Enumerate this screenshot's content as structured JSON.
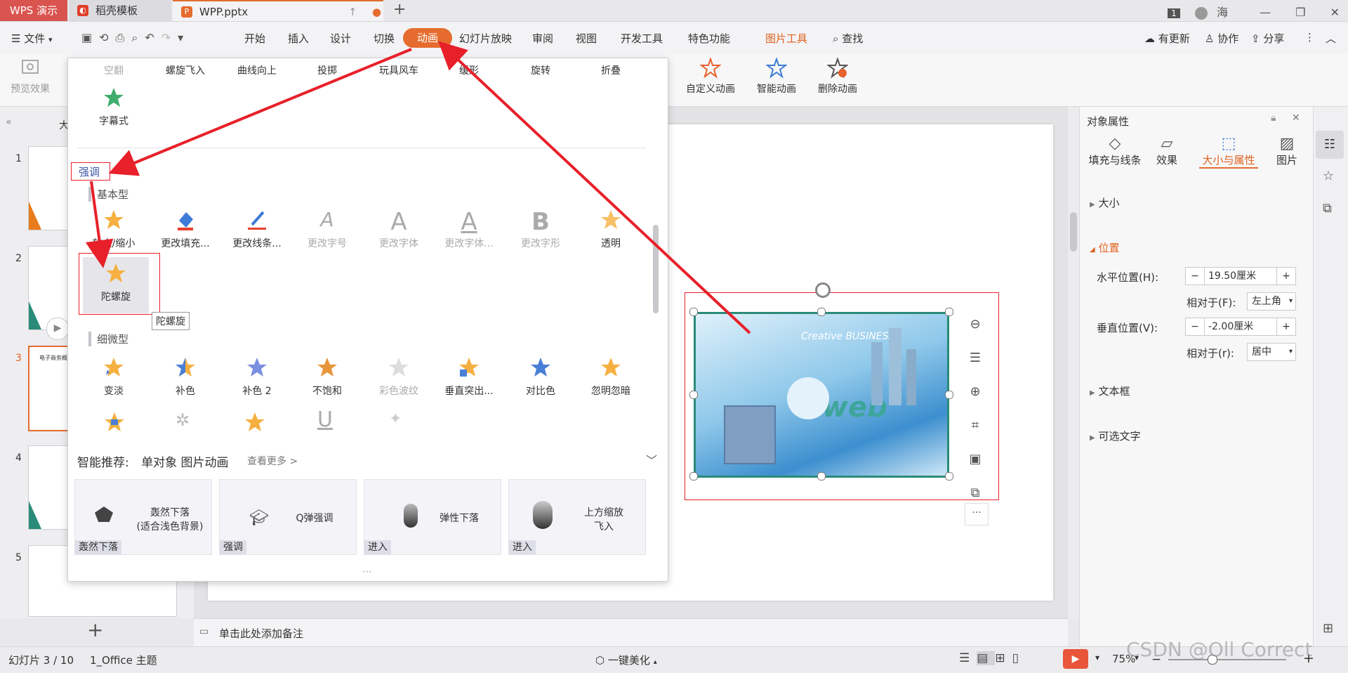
{
  "titlebar": {
    "app_tab": "WPS 演示",
    "template_tab": "稻壳模板",
    "file_tab": "WPP.pptx",
    "window_badge": "1",
    "user": "海"
  },
  "menu": {
    "file": "文件",
    "items": [
      "开始",
      "插入",
      "设计",
      "切换",
      "动画",
      "幻灯片放映",
      "审阅",
      "视图",
      "开发工具",
      "特色功能"
    ],
    "picture_tools": "图片工具",
    "search": "查找",
    "update": "有更新",
    "collab": "协作",
    "share": "分享"
  },
  "ribbon": {
    "preview": "预览效果",
    "custom_anim": "自定义动画",
    "smart_anim": "智能动画",
    "delete_anim": "删除动画"
  },
  "dropdown": {
    "top_row": [
      "空翻",
      "螺旋飞入",
      "曲线向上",
      "投掷",
      "玩具风车",
      "缓形",
      "旋转",
      "折叠"
    ],
    "caption": "字幕式",
    "section_emphasis": "强调",
    "sub_basic": "基本型",
    "basic_items": [
      "放大/缩小",
      "更改填充...",
      "更改线条...",
      "更改字号",
      "更改字体",
      "更改字体...",
      "更改字形",
      "透明"
    ],
    "gyro": "陀螺旋",
    "tooltip": "陀螺旋",
    "sub_subtle": "细微型",
    "subtle_items": [
      "变淡",
      "补色",
      "补色 2",
      "不饱和",
      "彩色波纹",
      "垂直突出...",
      "对比色",
      "忽明忽暗"
    ],
    "smart_label": "智能推荐:",
    "smart_desc": "单对象 图片动画",
    "see_more": "查看更多 >",
    "cards": [
      {
        "title": "轰然下落\n(适合浅色背景)",
        "tag": "轰然下落"
      },
      {
        "title": "Q弹强调",
        "tag": "强调"
      },
      {
        "title": "弹性下落",
        "tag": "进入"
      },
      {
        "title": "上方缩放\n飞入",
        "tag": "进入"
      }
    ]
  },
  "thumbs": {
    "numbers": [
      "1",
      "2",
      "3",
      "4",
      "5"
    ],
    "label_partial": "大",
    "slide3_title": "电子商务概述"
  },
  "slide_image": {
    "brand_small": "Creative BUSINESS",
    "web_text": "web"
  },
  "rpanel": {
    "title": "对象属性",
    "tabs": [
      "填充与线条",
      "效果",
      "大小与属性",
      "图片"
    ],
    "size": "大小",
    "position": "位置",
    "h_pos_label": "水平位置(H):",
    "h_pos_value": "19.50厘米",
    "rel_f_label": "相对于(F):",
    "rel_f_value": "左上角",
    "v_pos_label": "垂直位置(V):",
    "v_pos_value": "-2.00厘米",
    "rel_r_label": "相对于(r):",
    "rel_r_value": "居中",
    "textbox": "文本框",
    "alt_text": "可选文字"
  },
  "notes": "单击此处添加备注",
  "status": {
    "slide_info": "幻灯片 3 / 10",
    "theme": "1_Office 主题",
    "beautify": "一键美化",
    "zoom": "75%",
    "watermark": "CSDN @Oll Correct"
  },
  "colors": {
    "accent": "#e56c2e",
    "annotation_red": "#e8202a",
    "star_gold": "#f5b041",
    "star_blue": "#4a7fd6"
  }
}
